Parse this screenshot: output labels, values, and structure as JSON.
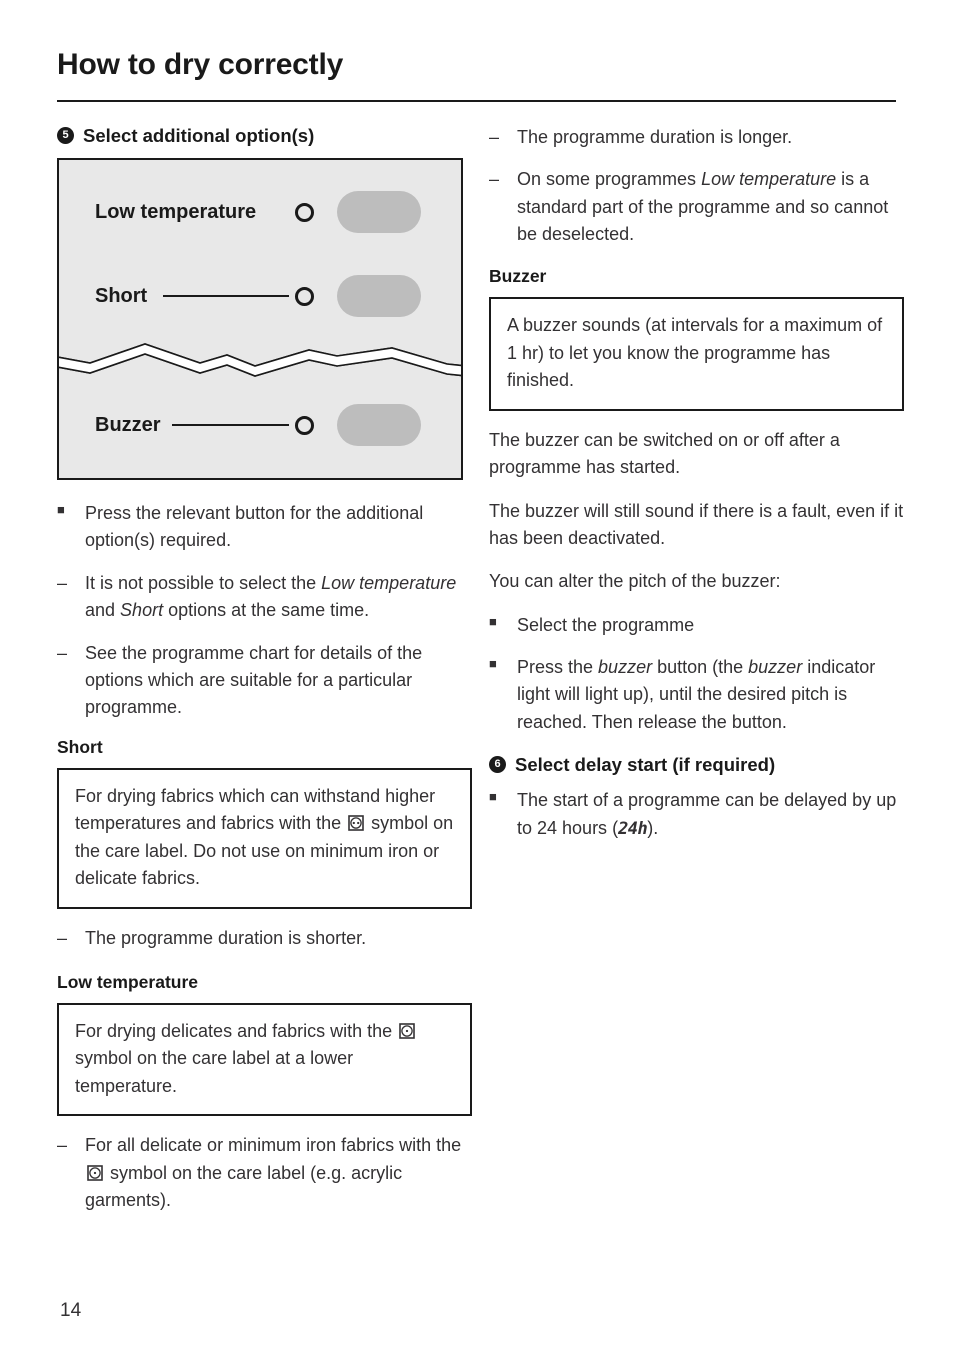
{
  "document": {
    "title": "How to dry correctly",
    "page_number": "14"
  },
  "left_column": {
    "step": {
      "number": "5",
      "label": "Select additional option(s)"
    },
    "illustration": {
      "rows": [
        {
          "label": "Low temperature",
          "indicator": "indicator-light-circle",
          "button": "option-button-pill",
          "has_leader_line": false
        },
        {
          "label": "Short",
          "indicator": "indicator-light-circle",
          "button": "option-button-pill",
          "has_leader_line": true
        },
        {
          "label": "Buzzer",
          "indicator": "indicator-light-circle",
          "button": "option-button-pill",
          "has_leader_line": true
        }
      ],
      "break_marker": "zigzag-break-line"
    },
    "bullets": [
      {
        "marker": "square",
        "parts": [
          {
            "text": "Press the relevant button for the additional option(s) required.",
            "style": "normal"
          }
        ]
      },
      {
        "marker": "dash",
        "parts": [
          {
            "text": "It is not possible to select the ",
            "style": "normal"
          },
          {
            "text": "Low temperature",
            "style": "italic"
          },
          {
            "text": " and ",
            "style": "normal"
          },
          {
            "text": "Short",
            "style": "italic"
          },
          {
            "text": " options at the same time.",
            "style": "normal"
          }
        ]
      },
      {
        "marker": "dash",
        "parts": [
          {
            "text": "See the programme chart for details of the options which are suitable for a particular programme.",
            "style": "normal"
          }
        ]
      }
    ],
    "short_section": {
      "heading": "Short",
      "note_parts": [
        {
          "text": "For drying fabrics which can withstand higher temperatures and fabrics with the ",
          "style": "normal"
        },
        {
          "text": "care-symbol-two-dots",
          "style": "symbol"
        },
        {
          "text": " symbol on the care label. Do not use on minimum iron or delicate fabrics.",
          "style": "normal"
        }
      ],
      "bullet": {
        "marker": "dash",
        "text": "The programme duration is shorter."
      }
    },
    "low_temperature_section": {
      "heading": "Low temperature",
      "note_parts": [
        {
          "text": "For drying delicates and fabrics with the ",
          "style": "normal"
        },
        {
          "text": "care-symbol-one-dot",
          "style": "symbol"
        },
        {
          "text": " symbol on the care label at a lower temperature.",
          "style": "normal"
        }
      ],
      "bullet_parts": [
        {
          "text": "For all delicate or minimum iron fabrics with the ",
          "style": "normal"
        },
        {
          "text": "care-symbol-one-dot",
          "style": "symbol"
        },
        {
          "text": " symbol on the care label (e.g. acrylic garments).",
          "style": "normal"
        }
      ],
      "bullet_marker": "dash"
    }
  },
  "right_column": {
    "top_bullets": [
      {
        "marker": "dash",
        "parts": [
          {
            "text": "The programme duration is longer.",
            "style": "normal"
          }
        ]
      },
      {
        "marker": "dash",
        "parts": [
          {
            "text": "On some programmes ",
            "style": "normal"
          },
          {
            "text": "Low temperature",
            "style": "italic"
          },
          {
            "text": " is a standard part of the programme and so cannot be deselected.",
            "style": "normal"
          }
        ]
      }
    ],
    "buzzer_section": {
      "heading": "Buzzer",
      "note": "A buzzer sounds (at intervals for a maximum of 1 hr) to let you know the programme has finished.",
      "paragraphs": [
        "The buzzer can be switched on or off after a programme has started.",
        "The buzzer will still sound if there is a fault, even if it has been deactivated.",
        "You can alter the pitch of the buzzer:"
      ],
      "bullets": [
        {
          "marker": "square",
          "parts": [
            {
              "text": "Select the programme",
              "style": "normal"
            }
          ]
        },
        {
          "marker": "square",
          "parts": [
            {
              "text": "Press the ",
              "style": "normal"
            },
            {
              "text": "buzzer",
              "style": "italic"
            },
            {
              "text": " button (the ",
              "style": "normal"
            },
            {
              "text": "buzzer",
              "style": "italic"
            },
            {
              "text": " indicator light will light up), until the desired pitch is reached. Then release the button.",
              "style": "normal"
            }
          ]
        }
      ]
    },
    "delay_step": {
      "number": "6",
      "label": "Select delay start (if required)",
      "bullet": {
        "marker": "square",
        "parts": [
          {
            "text": "The start of a programme can be delayed by up to 24 hours (",
            "style": "normal"
          },
          {
            "text": "24h",
            "style": "lcd"
          },
          {
            "text": ").",
            "style": "normal"
          }
        ]
      }
    }
  },
  "markers": {
    "square": "■",
    "dash": "–"
  },
  "colors": {
    "text": "#333133",
    "heading": "#1a1a1a",
    "panel_background": "#e8e8e8",
    "panel_border": "#1a1a1a",
    "pill": "#bdbdbd",
    "page_background": "#ffffff"
  }
}
